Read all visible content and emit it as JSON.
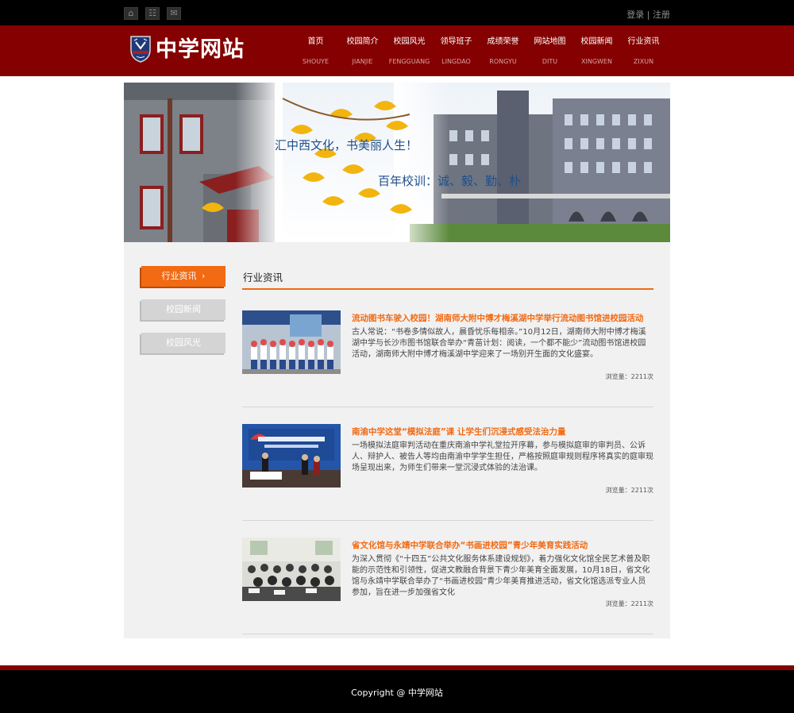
{
  "topbar": {
    "icons": [
      "home-icon",
      "sitemap-icon",
      "mail-icon"
    ],
    "login": "登录",
    "separator": " | ",
    "register": "注册"
  },
  "header": {
    "logo_text": "中学网站",
    "nav": [
      {
        "cn": "首页",
        "py": "SHOUYE"
      },
      {
        "cn": "校园简介",
        "py": "JIANJIE"
      },
      {
        "cn": "校园风光",
        "py": "FENGGUANG"
      },
      {
        "cn": "领导班子",
        "py": "LINGDAO"
      },
      {
        "cn": "成绩荣誉",
        "py": "RONGYU"
      },
      {
        "cn": "网站地图",
        "py": "DITU"
      },
      {
        "cn": "校园新闻",
        "py": "XINGWEN"
      },
      {
        "cn": "行业资讯",
        "py": "ZIXUN"
      }
    ]
  },
  "banner": {
    "slogan1": "汇中西文化，书美丽人生！",
    "slogan2": "百年校训：诚、毅、勤、朴"
  },
  "sidebar": {
    "items": [
      {
        "label": "行业资讯",
        "active": true
      },
      {
        "label": "校园新闻",
        "active": false
      },
      {
        "label": "校园风光",
        "active": false
      }
    ]
  },
  "content": {
    "heading": "行业资讯",
    "articles": [
      {
        "title": "流动图书车驶入校园！湖南师大附中博才梅溪湖中学举行流动图书馆进校园活动",
        "desc": "古人常说：“书卷多情似故人，晨昏忧乐每相亲。”10月12日，湖南师大附中博才梅溪湖中学与长沙市图书馆联合举办“青苗计划：阅读，一个都不能少”流动图书馆进校园活动，湖南师大附中博才梅溪湖中学迎来了一场别开生面的文化盛宴。",
        "views": "浏览量：2211次"
      },
      {
        "title": "南渝中学这堂“模拟法庭”课 让学生们沉浸式感受法治力量",
        "desc": "一场模拟法庭审判活动在重庆南渝中学礼堂拉开序幕，参与模拟庭审的审判员、公诉人、辩护人、被告人等均由南渝中学学生担任，严格按照庭审规则程序将真实的庭审现场呈现出来，为师生们带来一堂沉浸式体验的法治课。",
        "views": "浏览量：2211次"
      },
      {
        "title": "省文化馆与永靖中学联合举办“书画进校园”青少年美育实践活动",
        "desc": "为深入贯彻《“十四五”公共文化服务体系建设规划》，着力强化文化馆全民艺术普及职能的示范性和引领性，促进文教融合背景下青少年美育全面发展，10月18日，省文化馆与永靖中学联合举办了“书画进校园”青少年美育推进活动，省文化馆选派专业人员参加，旨在进一步加强省文化",
        "views": "浏览量：2211次"
      }
    ]
  },
  "footer": {
    "copyright": "Copyright @ 中学网站"
  }
}
